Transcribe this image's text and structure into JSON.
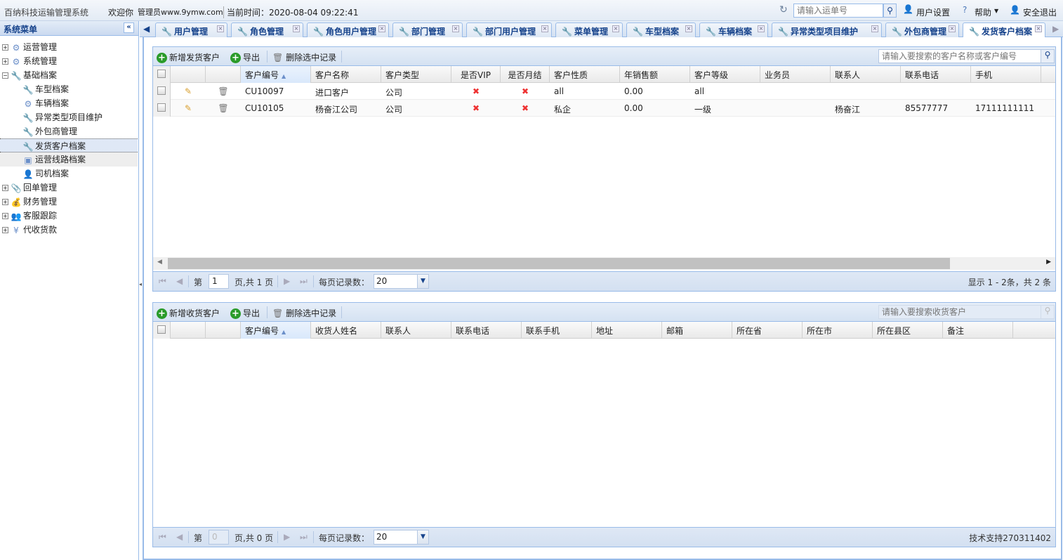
{
  "header": {
    "app_title": "百纳科技运输管理系统",
    "welcome": "欢迎你",
    "user": "管理员www.9ymw.com",
    "time_label": "当前时间：2020-08-04 09:22:41",
    "waybill_placeholder": "请输入运单号",
    "user_settings": "用户设置",
    "help": "帮助",
    "logout": "安全退出"
  },
  "sidebar": {
    "title": "系统菜单",
    "collapse": "«",
    "items": [
      {
        "label": "运营管理",
        "level": 0,
        "expand": "+",
        "icon": "flow-icon",
        "glyph": "⚙"
      },
      {
        "label": "系统管理",
        "level": 0,
        "expand": "+",
        "icon": "gear-icon",
        "glyph": "⚙"
      },
      {
        "label": "基础档案",
        "level": 0,
        "expand": "−",
        "icon": "wrench-icon",
        "glyph": "🔧"
      },
      {
        "label": "车型档案",
        "level": 1,
        "icon": "wrench-icon",
        "glyph": "🔧"
      },
      {
        "label": "车辆档案",
        "level": 1,
        "icon": "flow-icon",
        "glyph": "⚙"
      },
      {
        "label": "异常类型项目维护",
        "level": 1,
        "icon": "wrench-icon",
        "glyph": "🔧"
      },
      {
        "label": "外包商管理",
        "level": 1,
        "icon": "wrench-icon",
        "glyph": "🔧"
      },
      {
        "label": "发货客户档案",
        "level": 1,
        "icon": "wrench-icon",
        "glyph": "🔧",
        "selected": true
      },
      {
        "label": "运营线路档案",
        "level": 1,
        "icon": "route-icon",
        "glyph": "▣",
        "hover": true
      },
      {
        "label": "司机档案",
        "level": 1,
        "icon": "driver-icon",
        "glyph": "👤"
      },
      {
        "label": "回单管理",
        "level": 0,
        "expand": "+",
        "icon": "paperclip-icon",
        "glyph": "📎"
      },
      {
        "label": "财务管理",
        "level": 0,
        "expand": "+",
        "icon": "coins-icon",
        "glyph": "💰"
      },
      {
        "label": "客服跟踪",
        "level": 0,
        "expand": "+",
        "icon": "users-icon",
        "glyph": "👥"
      },
      {
        "label": "代收货款",
        "level": 0,
        "expand": "+",
        "icon": "yen-icon",
        "glyph": "¥"
      }
    ]
  },
  "tabs": [
    {
      "label": "用户管理"
    },
    {
      "label": "角色管理"
    },
    {
      "label": "角色用户管理"
    },
    {
      "label": "部门管理"
    },
    {
      "label": "部门用户管理"
    },
    {
      "label": "菜单管理"
    },
    {
      "label": "车型档案"
    },
    {
      "label": "车辆档案"
    },
    {
      "label": "异常类型项目维护"
    },
    {
      "label": "外包商管理"
    },
    {
      "label": "发货客户档案",
      "active": true
    }
  ],
  "grid1": {
    "toolbar": {
      "add": "新增发货客户",
      "export": "导出",
      "delete": "删除选中记录",
      "search_placeholder": "请输入要搜索的客户名称或客户编号"
    },
    "columns": [
      "客户编号",
      "客户名称",
      "客户类型",
      "是否VIP",
      "是否月结",
      "客户性质",
      "年销售额",
      "客户等级",
      "业务员",
      "联系人",
      "联系电话",
      "手机"
    ],
    "rows": [
      [
        "CU10097",
        "进口客户",
        "公司",
        "✖",
        "✖",
        "all",
        "0.00",
        "all",
        "",
        "",
        "",
        ""
      ],
      [
        "CU10105",
        "杨奋江公司",
        "公司",
        "✖",
        "✖",
        "私企",
        "0.00",
        "一级",
        "",
        "杨奋江",
        "85577777",
        "17111111111"
      ]
    ],
    "pager": {
      "page_prefix": "第",
      "page": "1",
      "page_suffix": "页,共 1 页",
      "per_page_label": "每页记录数：",
      "per_page": "20",
      "summary": "显示 1 - 2条，共 2 条"
    }
  },
  "grid2": {
    "toolbar": {
      "add": "新增收货客户",
      "export": "导出",
      "delete": "删除选中记录",
      "search_placeholder": "请输入要搜索收货客户"
    },
    "columns": [
      "客户编号",
      "收货人姓名",
      "联系人",
      "联系电话",
      "联系手机",
      "地址",
      "邮箱",
      "所在省",
      "所在市",
      "所在县区",
      "备注"
    ],
    "pager": {
      "page_prefix": "第",
      "page": "0",
      "page_suffix": "页,共 0 页",
      "per_page_label": "每页记录数：",
      "per_page": "20",
      "summary": "技术支持270311402"
    }
  }
}
